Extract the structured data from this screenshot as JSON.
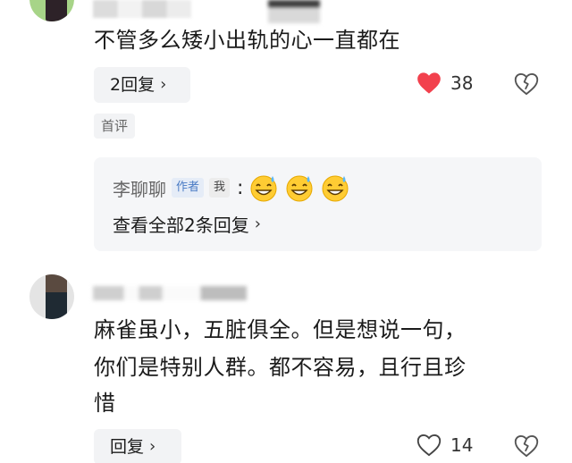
{
  "comment1": {
    "text": "不管多么矮小出轨的心一直都在",
    "reply_button": "2回复",
    "like_count": "38",
    "liked": true,
    "badge": "首评",
    "reply_panel": {
      "author_name": "李聊聊",
      "author_tag": "作者",
      "me_tag": "我",
      "colon": ":",
      "emoji": "grinning-sweat-emoji",
      "view_all": "查看全部2条回复"
    }
  },
  "comment2": {
    "text_line1": "麻雀虽小，五脏俱全。但是想说一句，",
    "text_line2": "你们是特别人群。都不容易，且行且珍",
    "text_line3": "惜",
    "reply_button": "回复",
    "like_count": "14",
    "liked": false
  },
  "colors": {
    "like_red": "#f2414d",
    "author_blue": "#4a7bc4",
    "pill_bg": "#f2f3f5"
  }
}
